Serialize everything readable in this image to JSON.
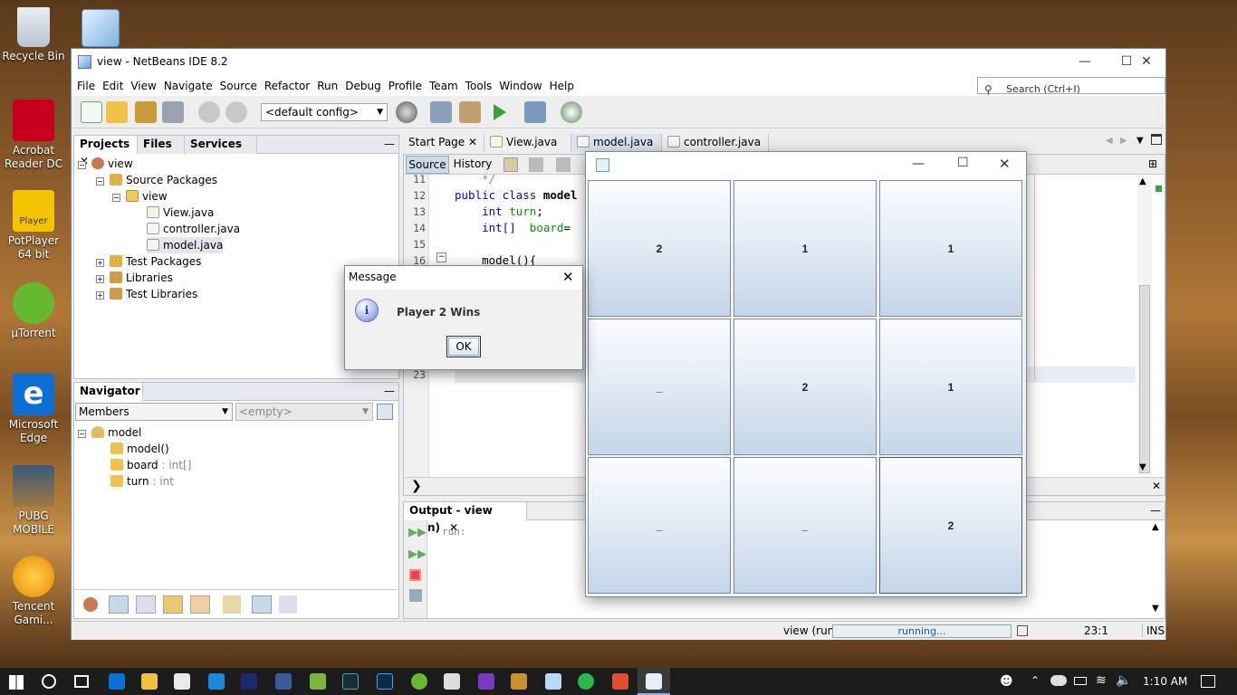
{
  "desktop": {
    "icons": [
      {
        "label": "Recycle Bin",
        "icon": "recycle-bin-icon"
      },
      {
        "label": "Acrobat Reader DC",
        "icon": "acrobat-icon"
      },
      {
        "label": "PotPlayer 64 bit",
        "icon": "potplayer-icon",
        "badge": "Player"
      },
      {
        "label": "µTorrent",
        "icon": "utorrent-icon"
      },
      {
        "label": "Microsoft Edge",
        "icon": "edge-icon"
      },
      {
        "label": "PUBG MOBILE",
        "icon": "pubg-icon"
      },
      {
        "label": "Tencent Gami...",
        "icon": "tencent-icon"
      }
    ]
  },
  "window": {
    "title": "view - NetBeans IDE 8.2",
    "menu": [
      "File",
      "Edit",
      "View",
      "Navigate",
      "Source",
      "Refactor",
      "Run",
      "Debug",
      "Profile",
      "Team",
      "Tools",
      "Window",
      "Help"
    ],
    "search_placeholder": "Search (Ctrl+I)",
    "config": "<default config>"
  },
  "projects_panel": {
    "tabs": [
      "Projects",
      "Files",
      "Services"
    ],
    "tree": [
      {
        "label": "view",
        "level": 0
      },
      {
        "label": "Source Packages",
        "level": 1
      },
      {
        "label": "view",
        "level": 2
      },
      {
        "label": "View.java",
        "level": 3
      },
      {
        "label": "controller.java",
        "level": 3
      },
      {
        "label": "model.java",
        "level": 3
      },
      {
        "label": "Test Packages",
        "level": 1
      },
      {
        "label": "Libraries",
        "level": 1
      },
      {
        "label": "Test Libraries",
        "level": 1
      }
    ]
  },
  "navigator": {
    "title": "Navigator",
    "members_label": "Members",
    "empty_label": "<empty>",
    "root": "model",
    "items": [
      {
        "name": "model()",
        "type": ""
      },
      {
        "name": "board",
        "type": " : int[]"
      },
      {
        "name": "turn",
        "type": " : int"
      }
    ]
  },
  "editor": {
    "tabs": [
      "Start Page",
      "View.java",
      "model.java",
      "controller.java"
    ],
    "active_tab": "model.java",
    "subtabs": [
      "Source",
      "History"
    ],
    "line_numbers": [
      "11",
      "12",
      "13",
      "14",
      "15",
      "16",
      "23"
    ],
    "code": {
      "l11": "    */",
      "l12_kw": "public class ",
      "l12_name": "model",
      "l13_kw": "    int ",
      "l13_fld": "turn",
      "l13_end": ";",
      "l14_kw": "    int[]  ",
      "l14_fld": "board",
      "l14_end": "= ",
      "l16": "    model(){"
    }
  },
  "output": {
    "title": "Output - view (run)",
    "text": "run:"
  },
  "statusbar": {
    "project": "view (run)",
    "progress": "running...",
    "position": "23:1",
    "mode": "INS"
  },
  "message_dialog": {
    "title": "Message",
    "text": "Player 2 Wins",
    "ok": "OK"
  },
  "game_window": {
    "cells": [
      "2",
      "1",
      "1",
      "_",
      "2",
      "1",
      "_",
      "_",
      "2"
    ]
  },
  "taskbar": {
    "time": "1:10 AM"
  }
}
